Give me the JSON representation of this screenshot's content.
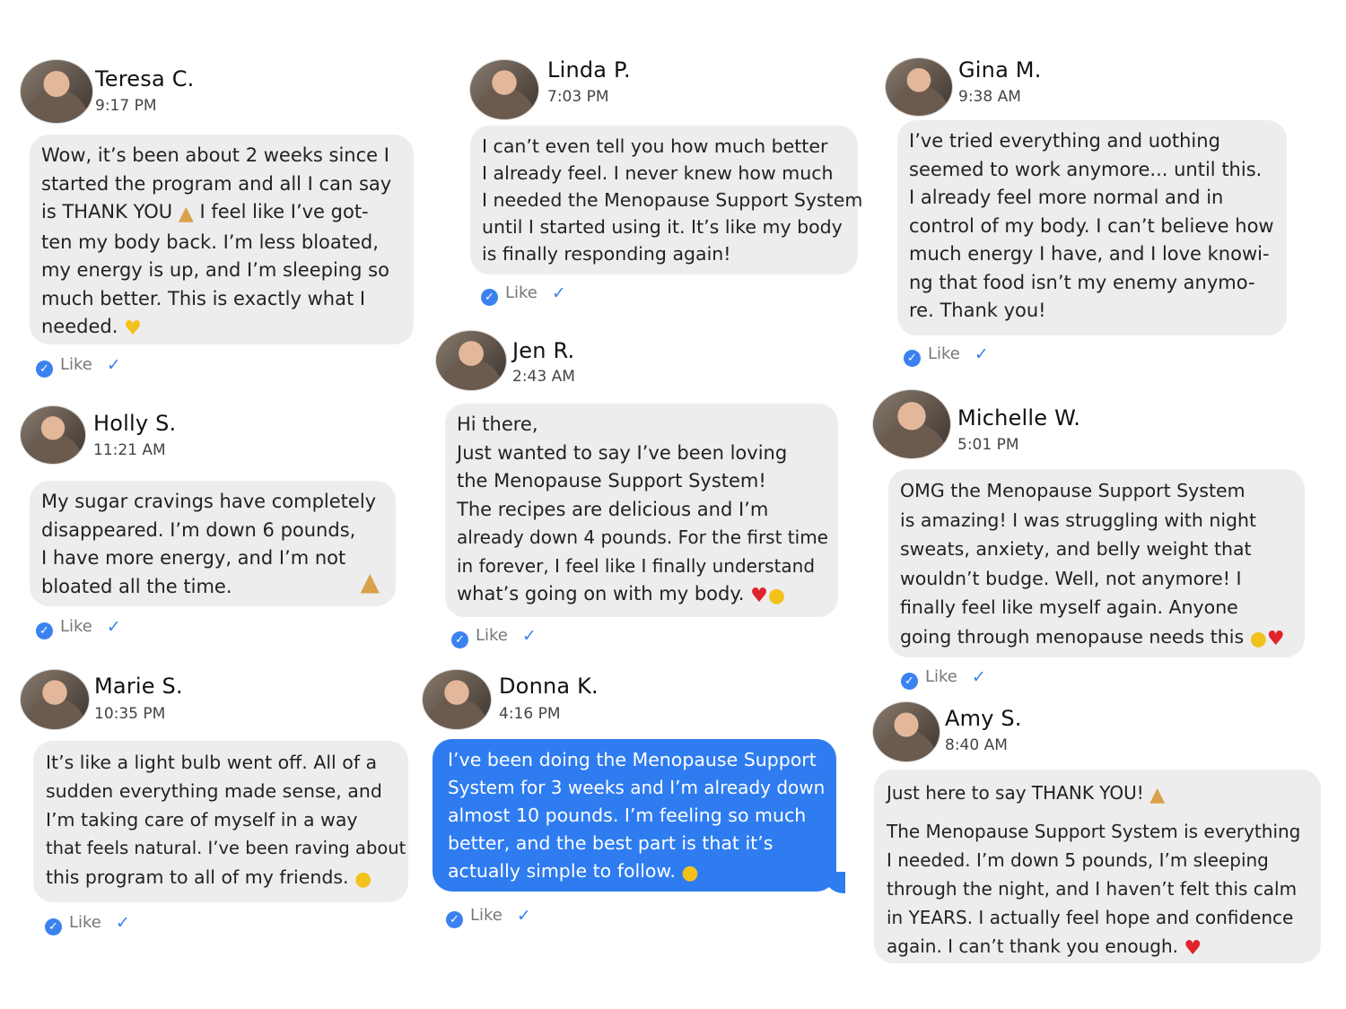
{
  "like_label": "Like",
  "colors": {
    "bubble_gray": "#ededee",
    "bubble_blue": "#2e7cf0",
    "check_blue": "#3b82f0",
    "heart": "#e0232c"
  },
  "cards": [
    {
      "name": "Teresa C.",
      "time": "9:17 PM",
      "lines": [
        "Wow, it’s been about 2 weeks since I",
        "started the program and all I can say",
        "is THANK YOU",
        "ten my body back. I’m less bloated,",
        "my energy is up, and I’m sleeping so",
        "much better. This is exactly what I",
        "needed."
      ],
      "line3_after": "I feel like I’ve got-",
      "emoji": [
        "pray-hands-emoji",
        "yellow-heart-emoji"
      ]
    },
    {
      "name": "Linda P.",
      "time": "7:03 PM",
      "lines": [
        "I can’t even tell you how much better",
        "I already feel. I never knew how much",
        "I needed the Menopause Support System",
        "until I started using it. It’s like my body",
        "is finally responding again!"
      ]
    },
    {
      "name": "Gina M.",
      "time": "9:38 AM",
      "lines": [
        "I’ve tried everything and uothing",
        "seemed to work anymore... until this.",
        "I already feel more normal and in",
        "control of my body. I can’t believe how",
        "much energy I have, and I love knowi-",
        "ng that food isn’t my enemy anymo-",
        "re. Thank you!"
      ]
    },
    {
      "name": "Holly S.",
      "time": "11:21 AM",
      "lines": [
        "My sugar cravings have completely",
        "disappeared. I’m down 6 pounds,",
        "I have more energy, and I’m not",
        "bloated all the time."
      ],
      "emoji": [
        "thumbs-up-emoji"
      ]
    },
    {
      "name": "Jen R.",
      "time": "2:43 AM",
      "lines": [
        "Hi there,",
        "Just wanted to say I’ve been loving",
        "the Menopause Support System!",
        "The recipes are delicious and I’m",
        "already down 4 pounds. For the first time",
        "in forever, I feel like I finally understand",
        "what’s going on with my body."
      ],
      "emoji": [
        "red-heart-emoji",
        "wink-emoji"
      ]
    },
    {
      "name": "Michelle W.",
      "time": "5:01 PM",
      "lines": [
        "OMG the Menopause Support System",
        "is amazing! I was struggling with night",
        "sweats, anxiety, and belly weight that",
        "wouldn’t budge. Well, not anymore! I",
        "finally feel like myself again. Anyone",
        "going through menopause needs this"
      ],
      "emoji": [
        "wink-emoji",
        "red-heart-emoji"
      ]
    },
    {
      "name": "Marie S.",
      "time": "10:35 PM",
      "lines": [
        "It’s like a light bulb went off. All of a",
        "sudden everything made sense, and",
        "I’m taking care of myself in a way",
        "that feels natural. I’ve been raving about",
        "this program to all of my friends."
      ],
      "emoji": [
        "wink-emoji"
      ]
    },
    {
      "name": "Donna K.",
      "time": "4:16 PM",
      "lines": [
        "I’ve been doing the Menopause Support",
        "System for 3 weeks and I’m already down",
        "almost 10 pounds. I’m feeling so much",
        "better, and the best part is that it’s",
        "actually simple to follow."
      ],
      "emoji": [
        "wink-emoji"
      ]
    },
    {
      "name": "Amy S.",
      "time": "8:40 AM",
      "lines": [
        "Just here to say THANK YOU!",
        "The Menopause Support System is everything",
        "I needed. I’m down 5 pounds, I’m sleeping",
        "through the night, and I haven’t felt this calm",
        "in YEARS. I actually feel hope and confidence",
        "again. I can’t thank you enough."
      ],
      "emoji": [
        "raising-hands-emoji",
        "red-heart-emoji"
      ]
    }
  ]
}
